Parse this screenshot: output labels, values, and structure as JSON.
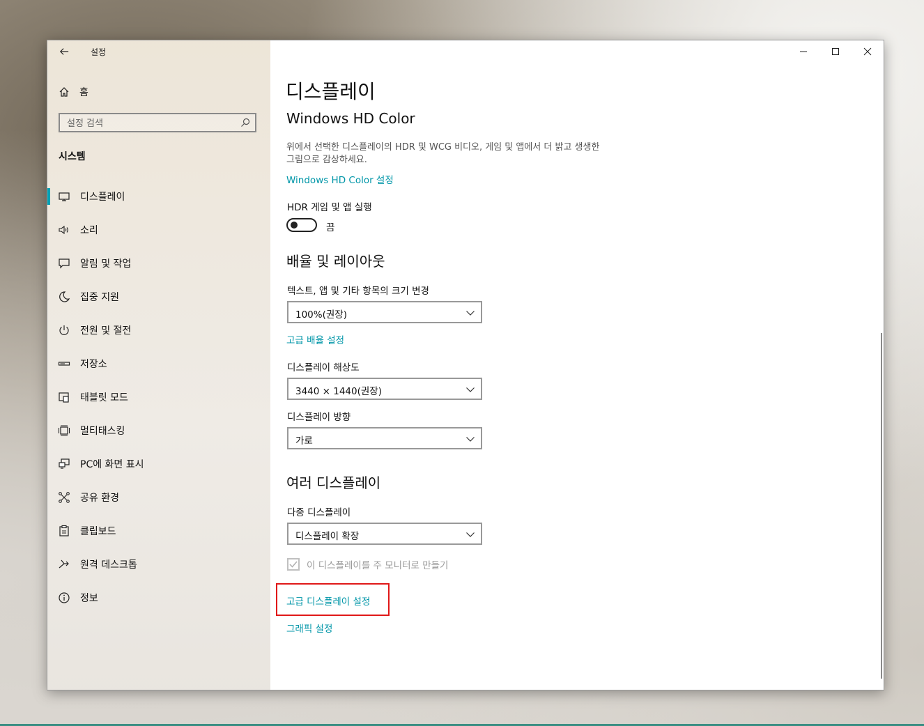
{
  "window": {
    "app_title": "설정",
    "home_label": "홈",
    "search_placeholder": "설정 검색",
    "section_title": "시스템"
  },
  "nav": {
    "items": [
      {
        "label": "디스플레이",
        "icon": "monitor-icon",
        "active": true
      },
      {
        "label": "소리",
        "icon": "speaker-icon"
      },
      {
        "label": "알림 및 작업",
        "icon": "notification-icon"
      },
      {
        "label": "집중 지원",
        "icon": "moon-icon"
      },
      {
        "label": "전원 및 절전",
        "icon": "power-icon"
      },
      {
        "label": "저장소",
        "icon": "storage-icon"
      },
      {
        "label": "태블릿 모드",
        "icon": "tablet-icon"
      },
      {
        "label": "멀티태스킹",
        "icon": "multitasking-icon"
      },
      {
        "label": "PC에 화면 표시",
        "icon": "project-icon"
      },
      {
        "label": "공유 환경",
        "icon": "share-icon"
      },
      {
        "label": "클립보드",
        "icon": "clipboard-icon"
      },
      {
        "label": "원격 데스크톱",
        "icon": "remote-desktop-icon"
      },
      {
        "label": "정보",
        "icon": "info-icon"
      }
    ]
  },
  "main": {
    "page_title": "디스플레이",
    "hdr": {
      "heading": "Windows HD Color",
      "description": "위에서 선택한 디스플레이의 HDR 및 WCG 비디오, 게임 및 앱에서 더 밝고 생생한 그림으로 감상하세요.",
      "link": "Windows HD Color 설정",
      "toggle_label": "HDR 게임 및 앱 실행",
      "toggle_state": "끔"
    },
    "scale": {
      "heading": "배율 및 레이아웃",
      "size_label": "텍스트, 앱 및 기타 항목의 크기 변경",
      "size_value": "100%(권장)",
      "advanced_link": "고급 배율 설정",
      "resolution_label": "디스플레이 해상도",
      "resolution_value": "3440 × 1440(권장)",
      "orientation_label": "디스플레이 방향",
      "orientation_value": "가로"
    },
    "multi": {
      "heading": "여러 디스플레이",
      "multi_label": "다중 디스플레이",
      "multi_value": "디스플레이 확장",
      "checkbox_label": "이 디스플레이를 주 모니터로 만들기",
      "checkbox_checked": true
    },
    "links": {
      "advanced_display": "고급 디스플레이 설정",
      "graphics": "그래픽 설정"
    }
  },
  "colors": {
    "accent": "#0096a8",
    "highlight": "#e01818"
  }
}
